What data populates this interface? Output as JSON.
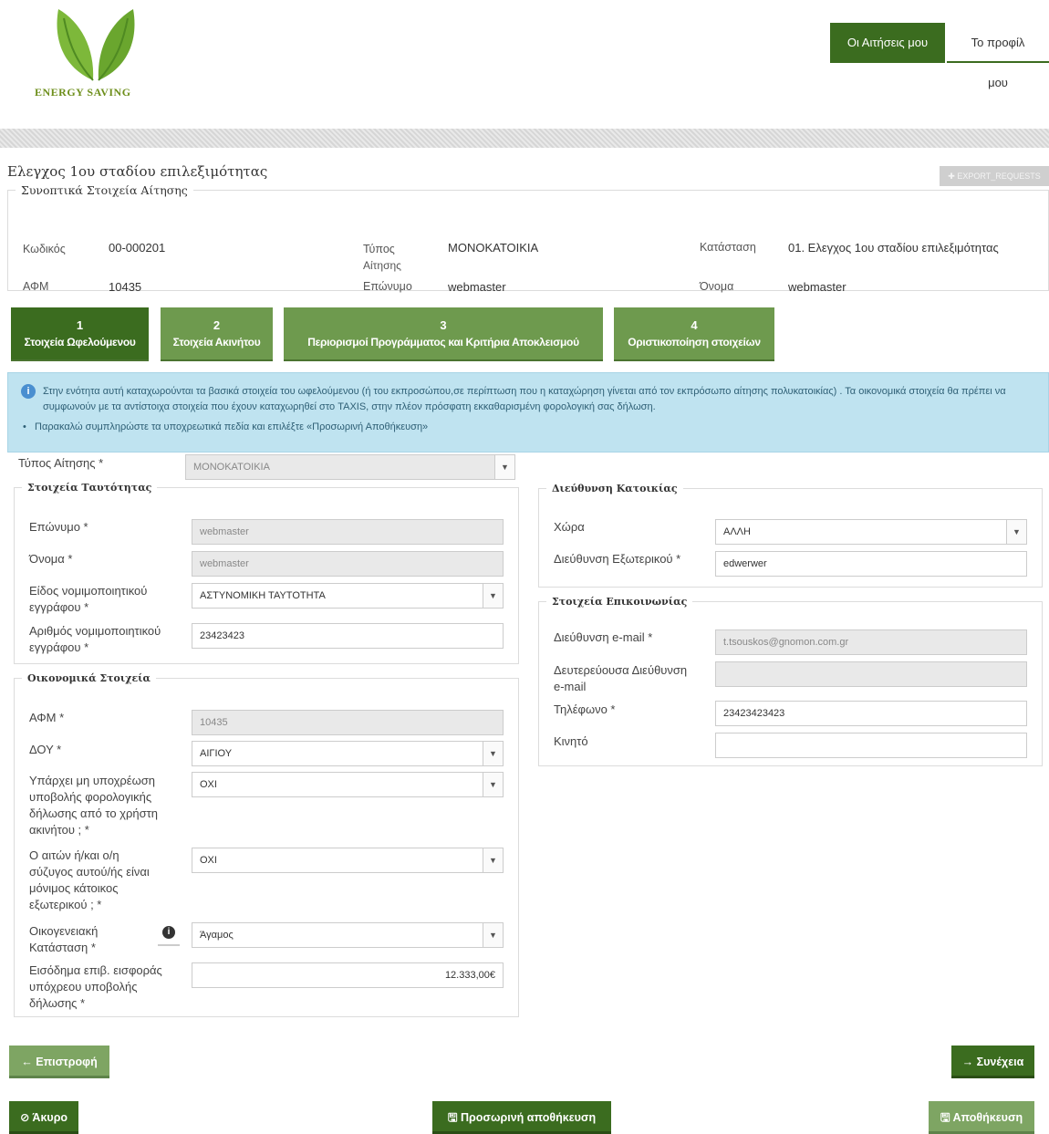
{
  "header": {
    "logo_text": "ENERGY SAVING",
    "nav": [
      {
        "label": "Οι Αιτήσεις μου",
        "active": true
      },
      {
        "label": "Το προφίλ μου",
        "active": false
      }
    ]
  },
  "page": {
    "title": "Ελεγχος 1ου σταδίου επιλεξιμότητας",
    "export_label": "EXPORT_REQUESTS"
  },
  "summary": {
    "legend": "Συνοπτικά Στοιχεία Αίτησης",
    "code_label": "Κωδικός",
    "code_value": "00-000201",
    "type_label_1": "Τύπος",
    "type_label_2": "Αίτησης",
    "type_value": "ΜΟΝΟΚΑΤΟΙΚΙΑ",
    "status_label": "Κατάσταση",
    "status_value": "01. Ελεγχος 1ου σταδίου επιλεξιμότητας",
    "afm_label": "ΑΦΜ",
    "afm_value": "10435",
    "surname_label": "Επώνυμο",
    "surname_value": "webmaster",
    "name_label": "Όνομα",
    "name_value": "webmaster"
  },
  "steps": [
    {
      "num": "1",
      "label": "Στοιχεία Ωφελούμενου",
      "active": true
    },
    {
      "num": "2",
      "label": "Στοιχεία Ακινήτου",
      "active": false
    },
    {
      "num": "3",
      "label": "Περιορισμοί Προγράμματος και Κριτήρια Αποκλεισμού",
      "active": false
    },
    {
      "num": "4",
      "label": "Οριστικοποίηση στοιχείων",
      "active": false
    }
  ],
  "info": {
    "text": "Στην ενότητα αυτή καταχωρούνται τα βασικά στοιχεία του ωφελούμενου (ή του εκπροσώπου,σε περίπτωση που η καταχώρηση γίνεται από τον εκπρόσωπο αίτησης πολυκατοικίας) . Τα οικονομικά στοιχεία θα πρέπει να συμφωνούν με τα αντίστοιχα στοιχεία που έχουν καταχωρηθεί στο TAXIS, στην πλέον πρόσφατη εκκαθαρισμένη φορολογική σας δήλωση.",
    "bullet": "Παρακαλώ συμπληρώστε τα υποχρεωτικά πεδία και επιλέξτε «Προσωρινή Αποθήκευση»"
  },
  "form": {
    "request_type": {
      "label": "Τύπος Αίτησης *",
      "value": "ΜΟΝΟΚΑΤΟΙΚΙΑ"
    },
    "identity": {
      "legend": "Στοιχεία Ταυτότητας",
      "surname": {
        "label": "Επώνυμο *",
        "value": "webmaster"
      },
      "name": {
        "label": "Όνομα *",
        "value": "webmaster"
      },
      "doc_type": {
        "label_1": "Είδος νομιμοποιητικού",
        "label_2": "εγγράφου *",
        "value": "ΑΣΤΥΝΟΜΙΚΗ ΤΑΥΤΟΤΗΤΑ"
      },
      "doc_number": {
        "label_1": "Αριθμός νομιμοποιητικού",
        "label_2": "εγγράφου *",
        "value": "23423423"
      }
    },
    "finance": {
      "legend": "Οικονομικά Στοιχεία",
      "afm": {
        "label": "ΑΦΜ *",
        "value": "10435"
      },
      "doy": {
        "label": "ΔΟΥ *",
        "value": "ΑΙΓΙΟΥ"
      },
      "no_obligation": {
        "label_1": "Υπάρχει μη υποχρέωση",
        "label_2": "υποβολής φορολογικής",
        "label_3": "δήλωσης από το χρήστη",
        "label_4": "ακινήτου ; *",
        "value": "ΟΧΙ"
      },
      "resident_abroad": {
        "label_1": "Ο αιτών ή/και ο/η",
        "label_2": "σύζυγος αυτού/ής είναι",
        "label_3": "μόνιμος κάτοικος",
        "label_4": "εξωτερικού ; *",
        "value": "ΟΧΙ"
      },
      "marital": {
        "label_1": "Οικογενειακή",
        "label_2": "Κατάσταση *",
        "value": "Άγαμος"
      },
      "income": {
        "label_1": "Εισόδημα επιβ. εισφοράς",
        "label_2": "υπόχρεου υποβολής",
        "label_3": "δήλωσης *",
        "value": "12.333,00€"
      }
    },
    "address": {
      "legend": "Διεύθυνση Κατοικίας",
      "country": {
        "label": "Χώρα",
        "value": "ΑΛΛΗ"
      },
      "foreign_address": {
        "label": "Διεύθυνση Εξωτερικού *",
        "value": "edwerwer"
      }
    },
    "contact": {
      "legend": "Στοιχεία Επικοινωνίας",
      "email": {
        "label": "Διεύθυνση e-mail *",
        "value": "t.tsouskos@gnomon.com.gr"
      },
      "email2": {
        "label_1": "Δευτερεύουσα Διεύθυνση",
        "label_2": "e-mail",
        "value": ""
      },
      "phone": {
        "label": "Τηλέφωνο *",
        "value": "23423423423"
      },
      "mobile": {
        "label": "Κινητό",
        "value": ""
      }
    }
  },
  "buttons": {
    "back": "← Επιστροφή",
    "next": "→ Συνέχεια",
    "cancel": "⊘ Άκυρο",
    "temp_save": "🖫 Προσωρινή αποθήκευση",
    "save": "🖫 Αποθήκευση"
  },
  "colors": {
    "primary": "#3b6c1f",
    "step_inactive": "#6e9a4e",
    "info_bg": "#bfe3f0"
  },
  "icons": [
    "logo-leaves-icon",
    "info-circle-icon",
    "chevron-down-icon",
    "help-info-icon",
    "arrow-left-icon",
    "arrow-right-icon",
    "save-icon",
    "cancel-icon"
  ]
}
